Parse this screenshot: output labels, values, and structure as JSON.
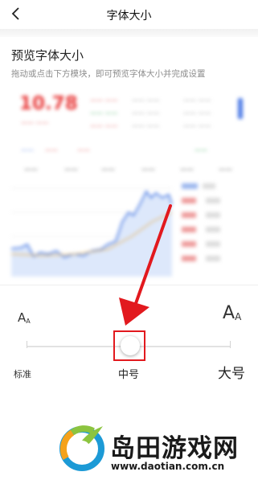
{
  "header": {
    "title": "字体大小"
  },
  "preview_section": {
    "title": "预览字体大小",
    "hint": "拖动或点击下方模块，即可预览字体大小并完成设置"
  },
  "font_size_control": {
    "labels": [
      "标准",
      "中号",
      "大号"
    ],
    "selected": "中号",
    "selected_index": 1,
    "small_icon": "A",
    "small_icon_sub": "A",
    "large_icon": "A",
    "large_icon_sub": "A",
    "highlight_color": "#e2191e"
  },
  "watermark": {
    "brand": "岛田游戏网",
    "url": "www.daotian.com.cn"
  },
  "icons": [
    "back-chevron-icon",
    "small-font-icon",
    "large-font-icon",
    "arrow-annotation-icon",
    "brand-logo-icon"
  ]
}
